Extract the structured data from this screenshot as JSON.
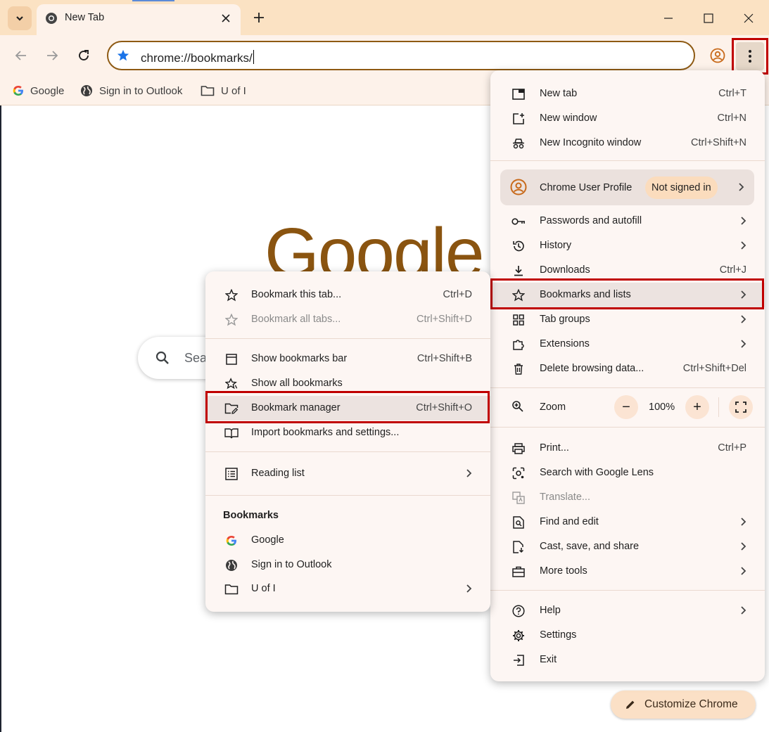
{
  "tab": {
    "title": "New Tab"
  },
  "omnibox": {
    "url": "chrome://bookmarks/"
  },
  "bookmarks_bar": [
    {
      "label": "Google",
      "icon": "google-g-icon"
    },
    {
      "label": "Sign in to Outlook",
      "icon": "globe-icon"
    },
    {
      "label": "U of I",
      "icon": "folder-icon"
    }
  ],
  "page": {
    "logo": "Google",
    "search_placeholder": "Sea",
    "customize_label": "Customize Chrome"
  },
  "main_menu": {
    "new_tab": {
      "label": "New tab",
      "shortcut": "Ctrl+T"
    },
    "new_window": {
      "label": "New window",
      "shortcut": "Ctrl+N"
    },
    "incognito": {
      "label": "New Incognito window",
      "shortcut": "Ctrl+Shift+N"
    },
    "profile": {
      "label": "Chrome User Profile",
      "status": "Not signed in"
    },
    "passwords": {
      "label": "Passwords and autofill"
    },
    "history": {
      "label": "History"
    },
    "downloads": {
      "label": "Downloads",
      "shortcut": "Ctrl+J"
    },
    "bookmarks": {
      "label": "Bookmarks and lists"
    },
    "tab_groups": {
      "label": "Tab groups"
    },
    "extensions": {
      "label": "Extensions"
    },
    "delete_data": {
      "label": "Delete browsing data...",
      "shortcut": "Ctrl+Shift+Del"
    },
    "zoom": {
      "label": "Zoom",
      "value": "100%",
      "minus": "−",
      "plus": "+"
    },
    "print": {
      "label": "Print...",
      "shortcut": "Ctrl+P"
    },
    "lens": {
      "label": "Search with Google Lens"
    },
    "translate": {
      "label": "Translate..."
    },
    "find_edit": {
      "label": "Find and edit"
    },
    "cast": {
      "label": "Cast, save, and share"
    },
    "more_tools": {
      "label": "More tools"
    },
    "help": {
      "label": "Help"
    },
    "settings": {
      "label": "Settings"
    },
    "exit": {
      "label": "Exit"
    }
  },
  "bookmarks_submenu": {
    "bookmark_tab": {
      "label": "Bookmark this tab...",
      "shortcut": "Ctrl+D"
    },
    "bookmark_all": {
      "label": "Bookmark all tabs...",
      "shortcut": "Ctrl+Shift+D"
    },
    "show_bar": {
      "label": "Show bookmarks bar",
      "shortcut": "Ctrl+Shift+B"
    },
    "show_all": {
      "label": "Show all bookmarks"
    },
    "manager": {
      "label": "Bookmark manager",
      "shortcut": "Ctrl+Shift+O"
    },
    "import": {
      "label": "Import bookmarks and settings..."
    },
    "reading_list": {
      "label": "Reading list"
    },
    "heading": "Bookmarks",
    "items": [
      {
        "label": "Google"
      },
      {
        "label": "Sign in to Outlook"
      },
      {
        "label": "U of I"
      }
    ]
  }
}
